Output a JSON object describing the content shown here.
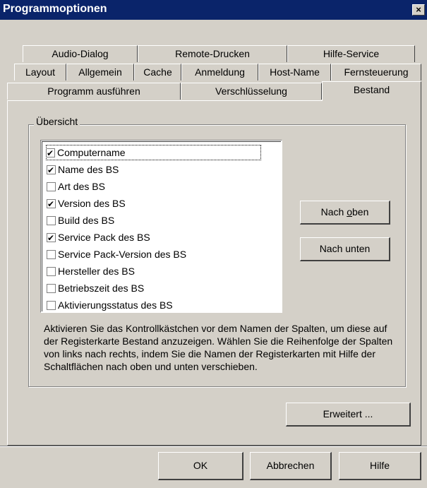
{
  "window": {
    "title": "Programmoptionen",
    "close_label": "×"
  },
  "tabs": {
    "row1": [
      "Audio-Dialog",
      "Remote-Drucken",
      "Hilfe-Service"
    ],
    "row2": [
      "Layout",
      "Allgemein",
      "Cache",
      "Anmeldung",
      "Host-Name",
      "Fernsteuerung"
    ],
    "row3": [
      "Programm ausführen",
      "Verschlüsselung",
      "Bestand"
    ],
    "active": "Bestand"
  },
  "group": {
    "label": "Übersicht"
  },
  "list": {
    "items": [
      {
        "label": "Computername",
        "checked": true
      },
      {
        "label": "Name des BS",
        "checked": true
      },
      {
        "label": "Art des BS",
        "checked": false
      },
      {
        "label": "Version des BS",
        "checked": true
      },
      {
        "label": "Build des BS",
        "checked": false
      },
      {
        "label": "Service Pack des BS",
        "checked": true
      },
      {
        "label": "Service Pack-Version des BS",
        "checked": false
      },
      {
        "label": "Hersteller des BS",
        "checked": false
      },
      {
        "label": "Betriebszeit des BS",
        "checked": false
      },
      {
        "label": "Aktivierungsstatus des BS",
        "checked": false
      }
    ],
    "scroll_up_icon": "▲",
    "scroll_down_icon": "▼"
  },
  "buttons": {
    "move_up": "Nach oben",
    "move_down": "Nach unten",
    "advanced": "Erweitert ...",
    "ok": "OK",
    "cancel": "Abbrechen",
    "help": "Hilfe"
  },
  "description": "Aktivieren Sie das Kontrollkästchen vor dem Namen der Spalten, um diese auf der Registerkarte Bestand anzuzeigen. Wählen Sie die Reihenfolge der Spalten von links nach rechts, indem Sie die Namen der Registerkarten mit Hilfe der Schaltflächen nach oben und unten verschieben."
}
